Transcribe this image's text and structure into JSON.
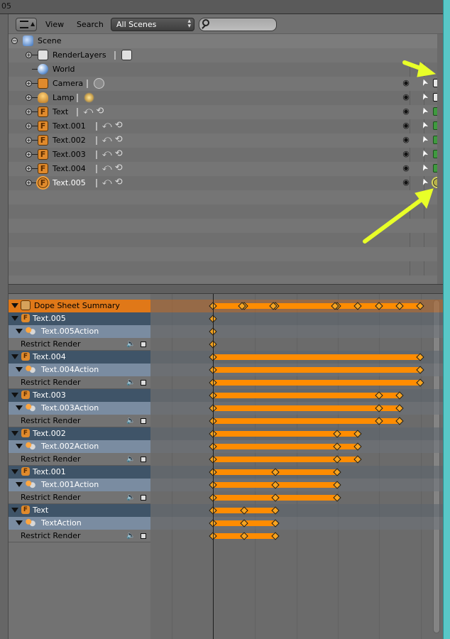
{
  "window": {
    "number": "05"
  },
  "outliner_header": {
    "view_menu": "View",
    "search_menu": "Search",
    "scene_selector": "All Scenes",
    "search_placeholder": ""
  },
  "outliner": {
    "rows": [
      {
        "name": "Scene",
        "type": "scene",
        "depth": 0,
        "expanded": true
      },
      {
        "name": "RenderLayers",
        "type": "renderlayers",
        "depth": 1,
        "has_render_icon": true
      },
      {
        "name": "World",
        "type": "world",
        "depth": 1
      },
      {
        "name": "Camera",
        "type": "camera",
        "depth": 1,
        "data_icon": "camera-data-icon",
        "render_state": "camera"
      },
      {
        "name": "Lamp",
        "type": "lamp",
        "depth": 1,
        "data_icon": "lamp-data-icon",
        "render_state": "camera"
      },
      {
        "name": "Text",
        "type": "text",
        "depth": 1,
        "render_state": "enabled"
      },
      {
        "name": "Text.001",
        "type": "text",
        "depth": 1,
        "render_state": "enabled"
      },
      {
        "name": "Text.002",
        "type": "text",
        "depth": 1,
        "render_state": "enabled"
      },
      {
        "name": "Text.003",
        "type": "text",
        "depth": 1,
        "render_state": "enabled"
      },
      {
        "name": "Text.004",
        "type": "text",
        "depth": 1,
        "render_state": "enabled"
      },
      {
        "name": "Text.005",
        "type": "text",
        "depth": 1,
        "render_state": "highlighted",
        "selected": true
      }
    ]
  },
  "dopesheet": {
    "summary_label": "Dope Sheet Summary",
    "channels": [
      {
        "kind": "object",
        "label": "Text.005"
      },
      {
        "kind": "action",
        "label": "Text.005Action"
      },
      {
        "kind": "fcurve",
        "label": "Restrict Render"
      },
      {
        "kind": "object",
        "label": "Text.004"
      },
      {
        "kind": "action",
        "label": "Text.004Action"
      },
      {
        "kind": "fcurve",
        "label": "Restrict Render"
      },
      {
        "kind": "object",
        "label": "Text.003"
      },
      {
        "kind": "action",
        "label": "Text.003Action"
      },
      {
        "kind": "fcurve",
        "label": "Restrict Render"
      },
      {
        "kind": "object",
        "label": "Text.002"
      },
      {
        "kind": "action",
        "label": "Text.002Action"
      },
      {
        "kind": "fcurve",
        "label": "Restrict Render"
      },
      {
        "kind": "object",
        "label": "Text.001"
      },
      {
        "kind": "action",
        "label": "Text.001Action"
      },
      {
        "kind": "fcurve",
        "label": "Restrict Render"
      },
      {
        "kind": "object",
        "label": "Text"
      },
      {
        "kind": "action",
        "label": "TextAction"
      },
      {
        "kind": "fcurve",
        "label": "Restrict Render"
      }
    ],
    "current_frame_mark": 0
  },
  "colors": {
    "keyframe": "#f7a420",
    "hold_bar": "#ff8c00",
    "summary": "#e07818",
    "annotation_arrow": "#e8ff28",
    "side_border": "#58c7c7"
  }
}
